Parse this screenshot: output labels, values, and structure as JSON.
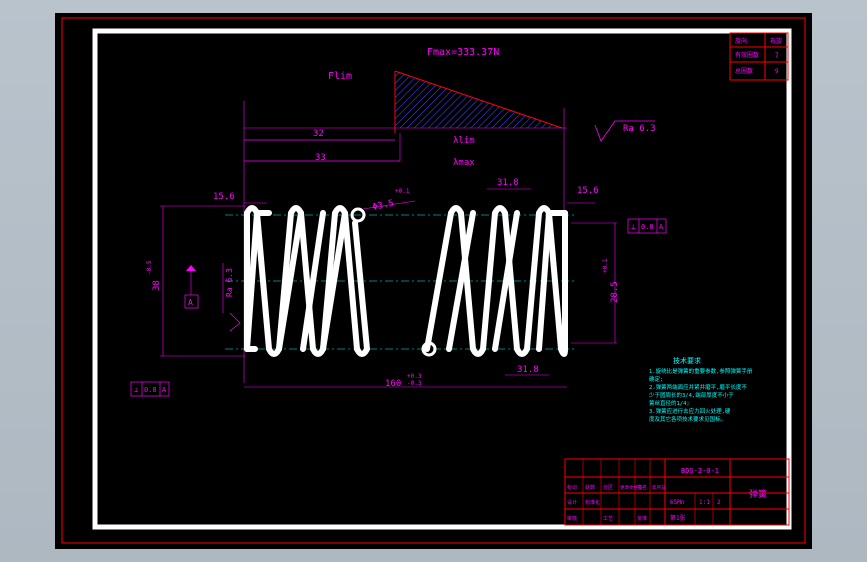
{
  "colors": {
    "background": "#000000",
    "sheet_border": "#ffffff",
    "outer_frame": "#ff0000",
    "dimension": "#ff00ff",
    "spring": "#ffffff",
    "centerline": "#00ffff",
    "hatch": "#3f3fff",
    "note_text": "#00ffff"
  },
  "force_diagram": {
    "fmax_label": "Fmax=333.37N",
    "flim_label": "Flim",
    "lambda_lim_label": "λlim",
    "lambda_max_label": "λmax",
    "dim_top_1": "32",
    "dim_top_2": "33"
  },
  "surface_finish": {
    "top_right": "Ra 6.3",
    "left_side": "Ra 6.3"
  },
  "dimensions": {
    "wire_diameter": "Φ3.5",
    "wire_tol": "+0.1",
    "left_pitch_end": "15.6",
    "right_pitch_end": "15.6",
    "top_pitch": "31.8",
    "bottom_pitch": "31.8",
    "free_length": "160",
    "free_length_tol_up": "+0.3",
    "free_length_tol_low": "-0.3",
    "outer_diameter": "38",
    "outer_tol": "-0.5",
    "inner_diameter": "28.5",
    "inner_tol": "+0.1"
  },
  "tolerance_frames": {
    "right": {
      "symbol": "⊥",
      "value": "0.8",
      "datum": "A"
    },
    "left": {
      "symbol": "⊥",
      "value": "0.8",
      "datum": "A"
    },
    "datum_label": "A"
  },
  "notes": {
    "title": "技术要求",
    "lines": [
      "1.旋绕比是弹簧的重要参数,参照弹簧手册",
      "确定;",
      "2.弹簧两端面应并紧并磨平,磨平长度不",
      "少于圆周长的3/4,端部厚度不小于",
      "簧丝直径的1/4;",
      "3.弹簧应进行去应力回火处理,硬",
      "度及其它各项技术要求见国标。"
    ]
  },
  "corner_table": {
    "rows": [
      {
        "label": "旋向",
        "value": "右旋"
      },
      {
        "label": "有效圈数",
        "value": "7"
      },
      {
        "label": "总圈数",
        "value": "9"
      }
    ]
  },
  "title_block": {
    "drawing_no": "BDS-2-0-1",
    "part_name": "弹簧",
    "material": "65Mn",
    "scale": "1:1",
    "quantity": "2",
    "sheet": "第1张",
    "header_cells": [
      "标记",
      "处数",
      "分区",
      "更改文件号",
      "签名",
      "年月日"
    ],
    "role_cells": [
      "设计",
      "标准化",
      "审核",
      "工艺",
      "批准"
    ]
  }
}
